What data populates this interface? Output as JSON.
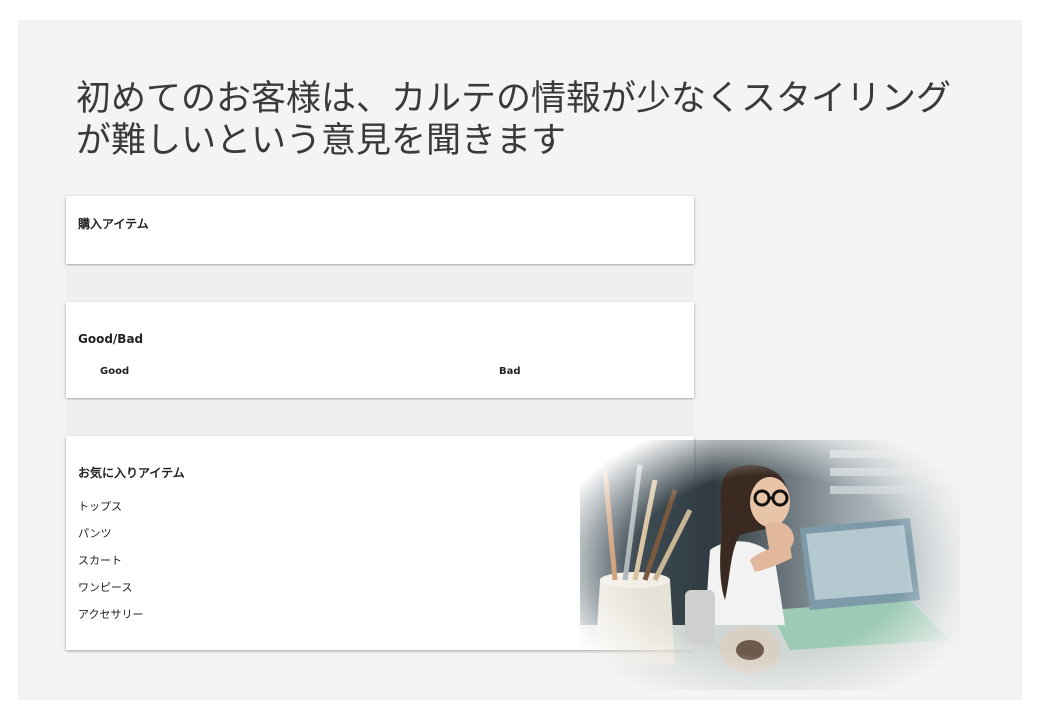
{
  "slide": {
    "headline_line1": "初めてのお客様は、カルテの情報が少なくスタイリング",
    "headline_line2": "が難しいという意見を聞きます"
  },
  "purchase": {
    "title": "購入アイテム"
  },
  "goodbad": {
    "title": "Good/Bad",
    "good_label": "Good",
    "bad_label": "Bad"
  },
  "favorites": {
    "title": "お気に入りアイテム",
    "items": [
      "トップス",
      "パンツ",
      "スカート",
      "ワンピース",
      "アクセサリー"
    ]
  },
  "photo": {
    "subject": "woman-thinking-at-laptop-photo"
  }
}
